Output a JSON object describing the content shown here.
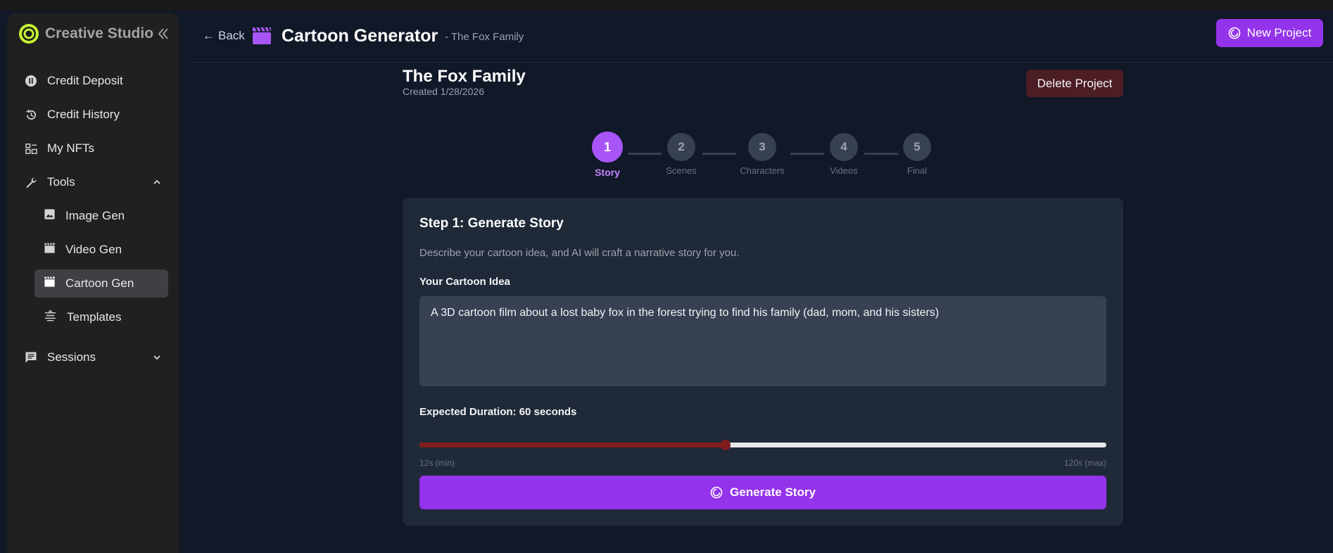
{
  "sidebar": {
    "brand": "Creative Studio",
    "items": [
      {
        "label": "Credit Deposit"
      },
      {
        "label": "Credit History"
      },
      {
        "label": "My NFTs"
      },
      {
        "label": "Tools"
      },
      {
        "label": "Sessions"
      }
    ],
    "tools": [
      {
        "label": "Image Gen"
      },
      {
        "label": "Video Gen"
      },
      {
        "label": "Cartoon Gen"
      },
      {
        "label": "Templates"
      }
    ]
  },
  "header": {
    "back": "Back",
    "title": "Cartoon Generator",
    "subtitle": "- The Fox Family",
    "new_project": "New Project"
  },
  "project": {
    "title": "The Fox Family",
    "created": "Created 1/28/2026",
    "delete": "Delete Project"
  },
  "steps": [
    {
      "num": "1",
      "label": "Story"
    },
    {
      "num": "2",
      "label": "Scenes"
    },
    {
      "num": "3",
      "label": "Characters"
    },
    {
      "num": "4",
      "label": "Videos"
    },
    {
      "num": "5",
      "label": "Final"
    }
  ],
  "story": {
    "title": "Step 1: Generate Story",
    "description": "Describe your cartoon idea, and AI will craft a narrative story for you.",
    "idea_label": "Your Cartoon Idea",
    "idea_value": "A 3D cartoon film about a lost baby fox in the forest trying to find his family (dad, mom, and his sisters)",
    "duration_label": "Expected Duration: 60 seconds",
    "duration_value": 60,
    "duration_min": 12,
    "duration_max": 120,
    "min_label": "12s (min)",
    "max_label": "120s (max)",
    "generate": "Generate Story"
  },
  "colors": {
    "accent": "#9333ea",
    "step_active": "#a855f7",
    "slider_fill": "#7f1d1d",
    "delete_bg": "#4c1d24"
  }
}
